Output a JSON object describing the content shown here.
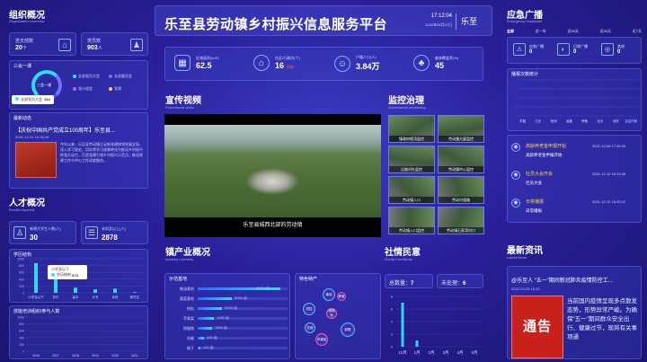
{
  "org": {
    "title": "组织概况",
    "sub": "Organization overview",
    "stats": [
      {
        "label": "党支部数",
        "value": "20",
        "unit": "个"
      },
      {
        "label": "党员数",
        "value": "903",
        "unit": "人"
      }
    ]
  },
  "three": {
    "title": "三会一课",
    "center": "三会一课",
    "items": [
      "支部党员大会",
      "支部委员会",
      "党小组会",
      "党课"
    ],
    "tip_label": "支部党员大会",
    "tip_value": "324"
  },
  "news": {
    "title": "最新动态",
    "headline": "【庆祝中国共产党成立100周年】乐至县...",
    "date": "2021-12-21 10:15:44",
    "body": "今年以来，乐至县劳动镇立足新党建统领发展全局，深入学习党史，切实将学习成果转化为推动乡村振兴的强大动力，打造党建引领乡村振兴示范点，推动党建工作与中心工作深度融合。"
  },
  "talent": {
    "title": "人才概况",
    "sub": "Events reported",
    "stats": [
      {
        "label": "新增大学生人数(人)",
        "value": "30"
      },
      {
        "label": "本科及以上(人)",
        "value": "2878"
      }
    ],
    "edu_title": "学历结构",
    "edu_tip_title": "小学及以下",
    "edu_tip_label": "学历结构",
    "edu_tip_value": "873",
    "edu_x": [
      "小学及以下",
      "初中",
      "高中",
      "大专",
      "本科",
      "研究生"
    ],
    "edu_y": [
      "1000",
      "800",
      "600",
      "400",
      "200",
      "0"
    ],
    "train_title": "技能培训组织/参与人数",
    "train_x": [
      "2016",
      "2017",
      "2018",
      "2019",
      "2020",
      "2021"
    ],
    "train_y": [
      "1000",
      "800",
      "600",
      "400",
      "200",
      "0"
    ]
  },
  "header": {
    "title": "乐至县劳动镇乡村振兴信息服务平台",
    "time": "17:12:04",
    "date": "2022年05月07日",
    "place": "乐至"
  },
  "kpis": [
    {
      "label": "区域面积(km²)",
      "value": "62.5",
      "extra": ""
    },
    {
      "label": "社区/行政村(个)",
      "value": "16",
      "extra": "详细"
    },
    {
      "label": "户籍人口(人)",
      "value": "3.84万",
      "extra": ""
    },
    {
      "label": "森林覆盖率(%)",
      "value": "45",
      "extra": ""
    }
  ],
  "video": {
    "title": "宣传视频",
    "sub": "Promotional video",
    "caption": "乐至县城西北部的劳动镇"
  },
  "monitor": {
    "title": "监控治理",
    "sub": "Governance monitoring",
    "tiles": [
      "镇政府楼顶监控",
      "劳动镇大厦监控",
      "沿路村社监控",
      "劳动镇中心监控",
      "劳动镇入口",
      "劳动村道路",
      "劳动镇入口监控",
      "劳动镇石家湾村口"
    ]
  },
  "industry": {
    "title": "镇产业概况",
    "sub": "Industry overview",
    "base_title": "示范基地",
    "special_title": "特色特产",
    "bars": [
      {
        "name": "粮油基地",
        "value": "8500 亩",
        "pct": 0.92
      },
      {
        "name": "蔬菜基地",
        "value": "3000 亩",
        "pct": 0.38
      },
      {
        "name": "柑桔",
        "value": "2000 亩",
        "pct": 0.27
      },
      {
        "name": "苹果梨",
        "value": "1330 亩",
        "pct": 0.18
      },
      {
        "name": "猕猴桃",
        "value": "1200 亩",
        "pct": 0.16
      },
      {
        "name": "花椒",
        "value": "430 亩",
        "pct": 0.07
      },
      {
        "name": "柚子",
        "value": "120 亩",
        "pct": 0.03
      }
    ],
    "bubbles": [
      "黄桃",
      "蜂蜜",
      "柑桔",
      "猕猴桃",
      "花椒",
      "苹果梨",
      "甜橙"
    ]
  },
  "social": {
    "title": "社情民意",
    "sub": "Social Conditions",
    "total_label": "总数量：",
    "total": "7",
    "pending_label": "未处理：",
    "pending": "6",
    "months": [
      "12月",
      "1月",
      "2月",
      "3月",
      "4月",
      "5月"
    ],
    "y": [
      "8",
      "6",
      "4",
      "2",
      "0"
    ]
  },
  "chart_data": [
    {
      "type": "bar",
      "title": "社情民意",
      "categories": [
        "12月",
        "1月",
        "2月",
        "3月",
        "4月",
        "5月"
      ],
      "values": [
        7,
        1,
        0,
        0,
        0,
        0
      ],
      "ylim": [
        0,
        8
      ]
    },
    {
      "type": "bar",
      "title": "学历结构",
      "categories": [
        "小学及以下",
        "初中",
        "高中",
        "大专",
        "本科",
        "研究生"
      ],
      "values": [
        873,
        600,
        150,
        100,
        120,
        20
      ],
      "ylim": [
        0,
        1000
      ]
    }
  ],
  "emergency": {
    "title": "应急广播",
    "sub": "Emergency broadcast",
    "tabs": [
      "全部",
      "近一年",
      "近90天",
      "近30天",
      "近7天"
    ],
    "kstats": [
      {
        "label": "应急广播",
        "value": "0"
      },
      {
        "label": "日常广播",
        "value": "0"
      },
      {
        "label": "其他",
        "value": "0"
      }
    ],
    "stat_title": "播报次数统计",
    "stat_x": [
      "早晨",
      "白天",
      "夜间",
      "凌晨",
      "傍晚",
      "全天",
      "深夜",
      "自定时段"
    ],
    "items": [
      {
        "title": "高龄养老金申报开始",
        "date": "2021-12-08 17:35:25",
        "sub": "高龄养老金申报开始"
      },
      {
        "title": "社员大会开会",
        "date": "2021-12-12 16:13:45",
        "sub": "社员大会"
      },
      {
        "title": "日常播报",
        "date": "2021-12-12 15:42:12",
        "sub": "日常播报"
      }
    ]
  },
  "latest": {
    "title": "最新资讯",
    "sub": "Latest News",
    "headline": "@乐至人 “五一”期间新冠肺炎疫情防控工...",
    "date": "2022-04-29 15:35",
    "poster": "通告",
    "body": "当前国内疫情呈现多点散发态势，形势异常严峻。为确保“五一”期间群众安全出行、健康过节，现将有关事项通"
  }
}
